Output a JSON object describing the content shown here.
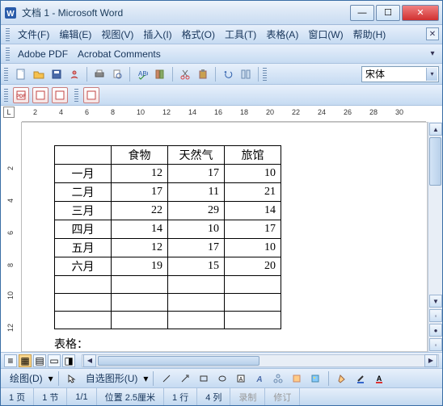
{
  "window": {
    "title": "文档 1 - Microsoft Word"
  },
  "menu": {
    "file": "文件(F)",
    "edit": "编辑(E)",
    "view": "视图(V)",
    "insert": "插入(I)",
    "format": "格式(O)",
    "tools": "工具(T)",
    "table": "表格(A)",
    "window": "窗口(W)",
    "help": "帮助(H)"
  },
  "pdfbar": {
    "adobe": "Adobe PDF",
    "acrobat": "Acrobat Comments"
  },
  "font": {
    "name": "宋体"
  },
  "ruler_numbers": [
    "2",
    "4",
    "6",
    "8",
    "10",
    "12",
    "14",
    "16",
    "18",
    "20",
    "22",
    "24",
    "26",
    "28",
    "30"
  ],
  "chart_data": {
    "type": "table",
    "title": "",
    "columns": [
      "",
      "食物",
      "天然气",
      "旅馆"
    ],
    "rows": [
      {
        "label": "一月",
        "values": [
          12,
          17,
          10
        ]
      },
      {
        "label": "二月",
        "values": [
          17,
          11,
          21
        ]
      },
      {
        "label": "三月",
        "values": [
          22,
          29,
          14
        ]
      },
      {
        "label": "四月",
        "values": [
          14,
          10,
          17
        ]
      },
      {
        "label": "五月",
        "values": [
          12,
          17,
          10
        ]
      },
      {
        "label": "六月",
        "values": [
          19,
          15,
          20
        ]
      }
    ],
    "empty_rows": 3
  },
  "caption": "表格：",
  "drawbar": {
    "draw": "绘图(D)",
    "autoshape": "自选图形(U)"
  },
  "status": {
    "page": "1 页",
    "section": "1 节",
    "pages": "1/1",
    "pos": "位置 2.5厘米",
    "line": "1 行",
    "col": "4 列",
    "rec": "录制",
    "rev": "修订"
  },
  "icons": {
    "min": "—",
    "max": "☐",
    "close": "✕",
    "dd": "▾",
    "up": "▲",
    "down": "▼",
    "left": "◀",
    "right": "▶"
  }
}
